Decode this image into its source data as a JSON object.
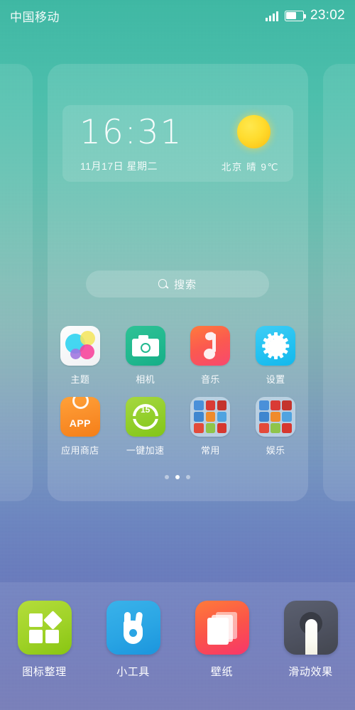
{
  "statusbar": {
    "carrier": "中国移动",
    "time": "23:02",
    "signal_icon": "signal-bars-icon",
    "battery_icon": "battery-icon",
    "battery_level_pct": 60
  },
  "clock_widget": {
    "time": "16:31",
    "date": "11月17日  星期二",
    "weather_icon": "sun-icon",
    "weather": "北京  晴  9℃"
  },
  "search": {
    "icon": "search-icon",
    "placeholder": "搜索"
  },
  "app_grid": {
    "rows": [
      [
        {
          "label": "主题",
          "icon": "theme-icon"
        },
        {
          "label": "相机",
          "icon": "camera-icon"
        },
        {
          "label": "音乐",
          "icon": "music-icon"
        },
        {
          "label": "设置",
          "icon": "settings-icon"
        }
      ],
      [
        {
          "label": "应用商店",
          "icon": "appstore-icon",
          "badge_text": "APP"
        },
        {
          "label": "一键加速",
          "icon": "boost-icon",
          "badge_text": "15"
        },
        {
          "label": "常用",
          "icon": "folder-icon"
        },
        {
          "label": "娱乐",
          "icon": "folder-icon"
        }
      ]
    ],
    "folder_tile_colors": [
      "#4a90d9",
      "#d93b35",
      "#c4342c",
      "#3f86cf",
      "#ef8b2c",
      "#4fa3e0",
      "#e34a3a",
      "#8fc44a",
      "#d6372f"
    ]
  },
  "page_dots": {
    "count": 3,
    "active_index": 1
  },
  "dock": {
    "items": [
      {
        "label": "图标整理",
        "icon": "icon-arrange-icon"
      },
      {
        "label": "小工具",
        "icon": "widgets-icon"
      },
      {
        "label": "壁纸",
        "icon": "wallpaper-icon"
      },
      {
        "label": "滑动效果",
        "icon": "slide-effect-icon"
      }
    ]
  },
  "colors": {
    "wallpaper_top": "#3fb8a4",
    "wallpaper_mid": "#7fa8b6",
    "wallpaper_bottom": "#6f76b4",
    "accent_sun": "#ffdc2e"
  }
}
